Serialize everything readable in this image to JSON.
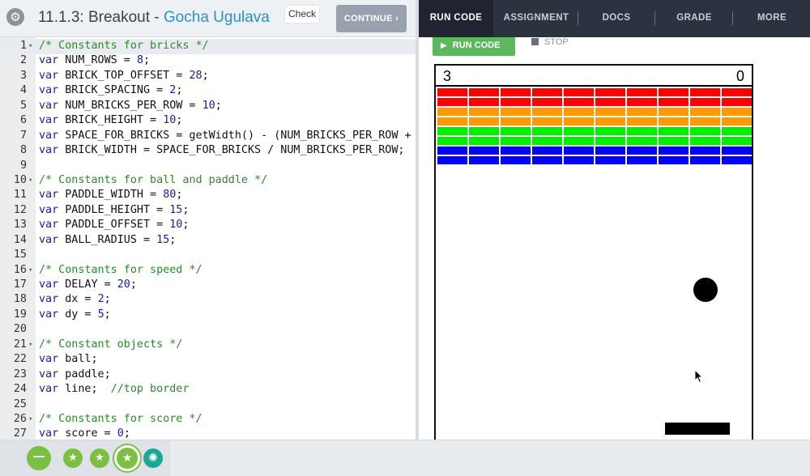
{
  "header": {
    "title_prefix": "11.1.3: Breakout - ",
    "author": "Gocha Ugulava",
    "check_label": "Check",
    "continue_label": "CONTINUE ›"
  },
  "nav": {
    "tabs": [
      {
        "label": "RUN CODE",
        "active": true
      },
      {
        "label": "ASSIGNMENT",
        "active": false
      },
      {
        "label": "DOCS",
        "active": false
      },
      {
        "label": "GRADE",
        "active": false
      },
      {
        "label": "MORE",
        "active": false
      }
    ]
  },
  "run_controls": {
    "run_label": "RUN CODE",
    "stop_label": "STOP"
  },
  "editor": {
    "lines": [
      {
        "n": "1",
        "fold": true,
        "parts": [
          [
            "comment",
            "/* Constants for bricks */"
          ]
        ]
      },
      {
        "n": "2",
        "parts": [
          [
            "kw",
            "var"
          ],
          [
            "plain",
            " NUM_ROWS = "
          ],
          [
            "num",
            "8"
          ],
          [
            "plain",
            ";"
          ]
        ]
      },
      {
        "n": "3",
        "parts": [
          [
            "kw",
            "var"
          ],
          [
            "plain",
            " BRICK_TOP_OFFSET = "
          ],
          [
            "num",
            "28"
          ],
          [
            "plain",
            ";"
          ]
        ]
      },
      {
        "n": "4",
        "parts": [
          [
            "kw",
            "var"
          ],
          [
            "plain",
            " BRICK_SPACING = "
          ],
          [
            "num",
            "2"
          ],
          [
            "plain",
            ";"
          ]
        ]
      },
      {
        "n": "5",
        "parts": [
          [
            "kw",
            "var"
          ],
          [
            "plain",
            " NUM_BRICKS_PER_ROW = "
          ],
          [
            "num",
            "10"
          ],
          [
            "plain",
            ";"
          ]
        ]
      },
      {
        "n": "6",
        "parts": [
          [
            "kw",
            "var"
          ],
          [
            "plain",
            " BRICK_HEIGHT = "
          ],
          [
            "num",
            "10"
          ],
          [
            "plain",
            ";"
          ]
        ]
      },
      {
        "n": "7",
        "parts": [
          [
            "kw",
            "var"
          ],
          [
            "plain",
            " SPACE_FOR_BRICKS = getWidth() - (NUM_BRICKS_PER_ROW +"
          ]
        ]
      },
      {
        "n": "8",
        "parts": [
          [
            "kw",
            "var"
          ],
          [
            "plain",
            " BRICK_WIDTH = SPACE_FOR_BRICKS / NUM_BRICKS_PER_ROW;"
          ]
        ]
      },
      {
        "n": "9",
        "parts": []
      },
      {
        "n": "10",
        "fold": true,
        "parts": [
          [
            "comment",
            "/* Constants for ball and paddle */"
          ]
        ]
      },
      {
        "n": "11",
        "parts": [
          [
            "kw",
            "var"
          ],
          [
            "plain",
            " PADDLE_WIDTH = "
          ],
          [
            "num",
            "80"
          ],
          [
            "plain",
            ";"
          ]
        ]
      },
      {
        "n": "12",
        "parts": [
          [
            "kw",
            "var"
          ],
          [
            "plain",
            " PADDLE_HEIGHT = "
          ],
          [
            "num",
            "15"
          ],
          [
            "plain",
            ";"
          ]
        ]
      },
      {
        "n": "13",
        "parts": [
          [
            "kw",
            "var"
          ],
          [
            "plain",
            " PADDLE_OFFSET = "
          ],
          [
            "num",
            "10"
          ],
          [
            "plain",
            ";"
          ]
        ]
      },
      {
        "n": "14",
        "parts": [
          [
            "kw",
            "var"
          ],
          [
            "plain",
            " BALL_RADIUS = "
          ],
          [
            "num",
            "15"
          ],
          [
            "plain",
            ";"
          ]
        ]
      },
      {
        "n": "15",
        "parts": []
      },
      {
        "n": "16",
        "fold": true,
        "parts": [
          [
            "comment",
            "/* Constants for speed */"
          ]
        ]
      },
      {
        "n": "17",
        "parts": [
          [
            "kw",
            "var"
          ],
          [
            "plain",
            " DELAY = "
          ],
          [
            "num",
            "20"
          ],
          [
            "plain",
            ";"
          ]
        ]
      },
      {
        "n": "18",
        "parts": [
          [
            "kw",
            "var"
          ],
          [
            "plain",
            " dx = "
          ],
          [
            "num",
            "2"
          ],
          [
            "plain",
            ";"
          ]
        ]
      },
      {
        "n": "19",
        "parts": [
          [
            "kw",
            "var"
          ],
          [
            "plain",
            " dy = "
          ],
          [
            "num",
            "5"
          ],
          [
            "plain",
            ";"
          ]
        ]
      },
      {
        "n": "20",
        "parts": []
      },
      {
        "n": "21",
        "fold": true,
        "parts": [
          [
            "comment",
            "/* Constant objects */"
          ]
        ]
      },
      {
        "n": "22",
        "parts": [
          [
            "kw",
            "var"
          ],
          [
            "plain",
            " ball;"
          ]
        ]
      },
      {
        "n": "23",
        "parts": [
          [
            "kw",
            "var"
          ],
          [
            "plain",
            " paddle;"
          ]
        ]
      },
      {
        "n": "24",
        "parts": [
          [
            "kw",
            "var"
          ],
          [
            "plain",
            " line;  "
          ],
          [
            "comment",
            "//top border"
          ]
        ]
      },
      {
        "n": "25",
        "parts": []
      },
      {
        "n": "26",
        "fold": true,
        "parts": [
          [
            "comment",
            "/* Constants for score */"
          ]
        ]
      },
      {
        "n": "27",
        "parts": [
          [
            "kw",
            "var"
          ],
          [
            "plain",
            " score = "
          ],
          [
            "num",
            "0"
          ],
          [
            "plain",
            ";"
          ]
        ]
      }
    ]
  },
  "game": {
    "score_left": "3",
    "score_right": "0",
    "brick_rows": 8,
    "bricks_per_row": 10,
    "row_colors": [
      "#ff0000",
      "#ff0000",
      "#ff9900",
      "#ff9900",
      "#00ee00",
      "#00ee00",
      "#0000ff",
      "#0000ff"
    ]
  },
  "icons": {
    "settings": "gear-icon",
    "expand": "expand-icon",
    "run": "play-icon",
    "stop": "stop-icon",
    "cursor": "mouse-pointer-icon"
  },
  "colors": {
    "accent_blue": "#2a8ed3",
    "run_green": "#5cb85c",
    "nav_bg": "#2c3240",
    "badge_green": "#7ac143",
    "badge_teal": "#1aa79a"
  }
}
